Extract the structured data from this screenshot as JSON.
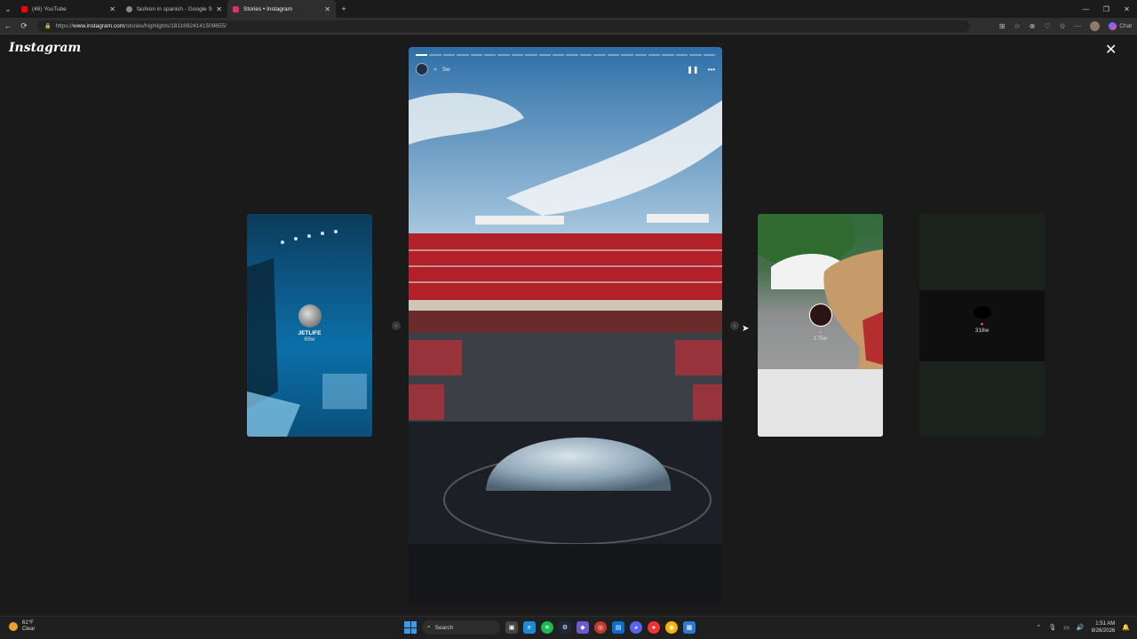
{
  "browser": {
    "tabs": [
      {
        "title": "(46) YouTube",
        "color": "#ff0000",
        "active": false
      },
      {
        "title": "fashion in spanish - Google Search",
        "color": "#888888",
        "active": false
      },
      {
        "title": "Stories • Instagram",
        "color": "#e1306c",
        "active": true
      }
    ],
    "url_prefix": "https://",
    "url_host": "www.instagram.com",
    "url_path": "/stories/highlights/18116924141509655/",
    "chat_label": "Chat"
  },
  "viewer": {
    "logo": "Instagram",
    "close_label": "✕"
  },
  "main_story": {
    "time": "5w",
    "segments_total": 22,
    "segments_done": 1
  },
  "prev_story": {
    "name": "JETLIFE",
    "age": "69w"
  },
  "next_story": {
    "name": "",
    "age": "175w"
  },
  "far_story": {
    "name": "",
    "age": "318w"
  },
  "taskbar": {
    "temperature": "61°F",
    "condition": "Clear",
    "search_label": "Search",
    "time": "1:51 AM",
    "date": "8/26/2026"
  },
  "colors": {
    "accent": "#0095f6"
  }
}
